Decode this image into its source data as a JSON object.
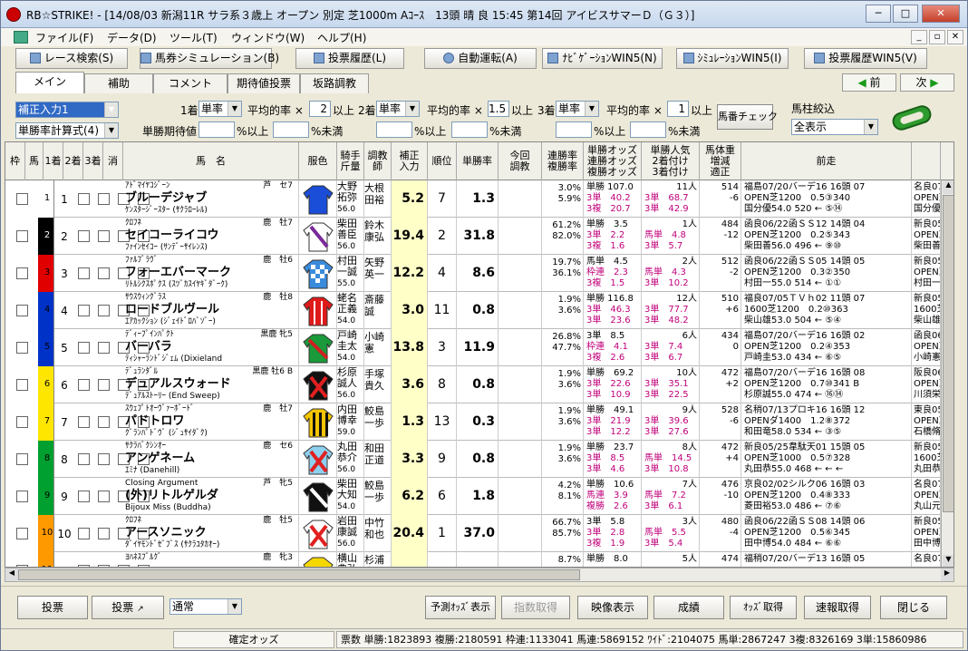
{
  "window": {
    "title": "RB☆STRIKE! - [14/08/03 新潟11R サラ系３歳上 オープン 別定 芝1000m Aｺｰｽ　13頭 晴 良 15:45 第14回 アイビスサマーＤ（Ｇ３）]"
  },
  "menu": [
    "ファイル(F)",
    "データ(D)",
    "ツール(T)",
    "ウィンドウ(W)",
    "ヘルプ(H)"
  ],
  "toolbar": [
    "レース検索(S)",
    "馬券シミュレーション(B)",
    "投票履歴(L)",
    "自動運転(A)",
    "ﾅﾋﾞｹﾞｰｼｮﾝWIN5(N)",
    "ｼﾐｭﾚｰｼｮﾝWIN5(I)",
    "投票履歴WIN5(V)"
  ],
  "tabs": [
    "メイン",
    "補助",
    "コメント",
    "期待値投票",
    "坂路調教"
  ],
  "nav": {
    "prev": "前",
    "next": "次"
  },
  "filter": {
    "preset": "補正入力1",
    "sort": "単勝率計算式(4)",
    "l1": "1着",
    "l2": "2着",
    "l3": "3着",
    "bet1": "単率",
    "bet2": "単率",
    "bet3": "単率",
    "avg": "平均的率 ×",
    "avg1": "2",
    "avg2": "1.5",
    "avg3": "1",
    "ijou": "以上",
    "exp": "単勝期待値",
    "pct_ijou": "%以上",
    "pct_miman": "%未満",
    "umaban_check": "馬番チェック",
    "hashira": "馬柱絞込",
    "display": "全表示"
  },
  "headers": [
    "枠",
    "馬",
    "1着",
    "2着",
    "3着",
    "消",
    "馬　名",
    "服色",
    "騎手\n斤量",
    "調教\n師",
    "補正\n入力",
    "順位",
    "単勝率",
    "今回\n調教",
    "連勝率\n複勝率",
    "単勝オッズ\n連勝オッズ\n複勝オッズ",
    "単勝人気\n2着付け\n3着付け",
    "馬体重\n増減\n適正",
    "前走",
    ""
  ],
  "colors": {
    "waku": [
      "#ffffff",
      "#000000",
      "#e00000",
      "#0032c8",
      "#ffe600",
      "#00a030",
      "#ff9900",
      "#ff80c0"
    ]
  },
  "rows": [
    {
      "waku": "1",
      "wc": 0,
      "num": "1",
      "sire": "ｱﾄﾞﾏｲﾔｺｼﾞｰﾝ",
      "sex": "芦　セ7",
      "name": "ブルーデジャブ",
      "dam": "ｹﾝｽﾀｰｼﾞｰｽﾀｰ (ｻｸﾗﾛｰﾚﾙ)",
      "jockey": "大野\n拓弥",
      "kg": "56.0",
      "trainer": "大根\n田裕",
      "hosei": "5.2",
      "rank": "7",
      "tan": "1.3",
      "ren": "3.0%",
      "fuku": "5.9%",
      "o1": "単勝 107.0",
      "o2": "3単　40.2",
      "o3": "3複　20.7",
      "p1": "11人",
      "p2": "3単　68.7",
      "p3": "3単　42.9",
      "w1": "514",
      "w2": "-6",
      "prev1": "福島07/20バーデ16 16頭 07",
      "prev2": "OPEN芝1200　0.5③340",
      "prev3": "国分優54.0 520 ← ⑤⑭",
      "last1": "名良07",
      "last2": "OPEN芝",
      "last3": "国分優",
      "silk": "blue"
    },
    {
      "waku": "2",
      "wc": 1,
      "num": "2",
      "sire": "ｸﾛﾌﾈ",
      "sex": "鹿　牡7",
      "name": "セイコーライコウ",
      "dam": "ﾌｧｲﾝｾｲｺｰ (ｻﾝﾃﾞｰｻｲﾚﾝｽ)",
      "jockey": "柴田\n善臣",
      "kg": "56.0",
      "trainer": "鈴木\n康弘",
      "hosei": "19.4",
      "rank": "2",
      "tan": "31.8",
      "ren": "61.2%",
      "fuku": "82.0%",
      "o1": "単勝　3.5",
      "o2": "3単　2.2",
      "o3": "3複　1.6",
      "p1": "1人",
      "p2": "馬単　4.8",
      "p3": "3単　5.7",
      "w1": "484",
      "w2": "-12",
      "prev1": "函良06/22函ＳＳ12 14頭 04",
      "prev2": "OPEN芝1200　0.2⑤343",
      "prev3": "柴田善56.0 496 ← ⑨⑩",
      "last1": "新良05",
      "last2": "OPEN芝",
      "last3": "柴田善",
      "silk": "white"
    },
    {
      "waku": "3",
      "wc": 2,
      "num": "3",
      "sire": "ﾌｧﾙﾌﾞﾗｳﾞ",
      "sex": "鹿　牡6",
      "name": "フォーエバーマーク",
      "dam": "ﾘﾄﾙｼｸｽﾎﾟｸｽ (ｽﾂﾞｶｽｲﾔｷﾞﾀﾞｰｸ)",
      "jockey": "村田\n一誠",
      "kg": "55.0",
      "trainer": "矢野\n英一",
      "hosei": "12.2",
      "rank": "4",
      "tan": "8.6",
      "ren": "19.7%",
      "fuku": "36.1%",
      "o1": "馬単　4.5",
      "o2": "枠連　2.3",
      "o3": "3複　1.5",
      "p1": "2人",
      "p2": "馬単　4.3",
      "p3": "3単　10.2",
      "w1": "512",
      "w2": "-2",
      "prev1": "函良06/22函ＳＳ05 14頭 05",
      "prev2": "OPEN芝1200　0.3②350",
      "prev3": "村田一55.0 514 ← ①①",
      "last1": "新良05",
      "last2": "OPEN芝",
      "last3": "村田一",
      "silk": "check"
    },
    {
      "waku": "4",
      "wc": 3,
      "num": "4",
      "sire": "ｻｳｽｳｨﾝｸﾞﾗｽ",
      "sex": "鹿　牡8",
      "name": "ロードブルヴール",
      "dam": "ｴｱｶｯｸｼｮﾝ (ｼﾞｪｲﾄﾞﾛﾊﾞｿﾞｰ)",
      "jockey": "蛯名\n正義",
      "kg": "54.0",
      "trainer": "斎藤\n誠",
      "hosei": "3.0",
      "rank": "11",
      "tan": "0.8",
      "ren": "1.9%",
      "fuku": "3.6%",
      "o1": "単勝 116.8",
      "o2": "3単　46.3",
      "o3": "3単　23.6",
      "p1": "12人",
      "p2": "3単　77.7",
      "p3": "3単　48.2",
      "w1": "510",
      "w2": "+6",
      "prev1": "福良07/05ＴＶｈ02 11頭 07",
      "prev2": "1600芝1200　0.2⑩363",
      "prev3": "柴山雄53.0 504 ← ⑤④",
      "last1": "新良05",
      "last2": "1600芝",
      "last3": "柴山雄",
      "silk": "red"
    },
    {
      "waku": "5",
      "wc": 3,
      "num": "5",
      "sire": "ﾃﾞｨｰﾌﾟｲﾝﾊﾟｸﾄ",
      "sex": "黒鹿 牝5",
      "name": "バーバラ",
      "dam": "ﾃｨｼｬｰﾗﾝﾄﾞｼﾞｪﾑ (Dixieland",
      "jockey": "戸崎\n圭太",
      "kg": "54.0",
      "trainer": "小崎\n憲",
      "hosei": "13.8",
      "rank": "3",
      "tan": "11.9",
      "ren": "26.8%",
      "fuku": "47.7%",
      "o1": "3単　8.5",
      "o2": "枠連　4.1",
      "o3": "3複　2.6",
      "p1": "6人",
      "p2": "3単　7.4",
      "p3": "3単　6.7",
      "w1": "434",
      "w2": "0",
      "prev1": "福島07/20バーデ16 16頭 02",
      "prev2": "OPEN芝1200　0.2④353",
      "prev3": "戸崎圭53.0 434 ← ⑥⑤",
      "last1": "函良06",
      "last2": "OPEN芝",
      "last3": "小崎憲",
      "silk": "green"
    },
    {
      "waku": "6",
      "wc": 4,
      "num": "6",
      "sire": "ﾃﾞｭﾗﾝﾀﾞﾙ",
      "sex": "黒鹿 牡6 B",
      "name": "デュアルスウォード",
      "dam": "ﾃﾞｭｱﾙｽﾄｰﾘｰ (End Sweep)",
      "jockey": "杉原\n誠人",
      "kg": "56.0",
      "trainer": "手塚\n貴久",
      "hosei": "3.6",
      "rank": "8",
      "tan": "0.8",
      "ren": "1.9%",
      "fuku": "3.6%",
      "o1": "単勝　69.2",
      "o2": "3単　22.6",
      "o3": "3単　10.9",
      "p1": "10人",
      "p2": "3単　35.1",
      "p3": "3単　22.5",
      "w1": "472",
      "w2": "+2",
      "prev1": "福島07/20バーデ16 16頭 08",
      "prev2": "OPEN芝1200　0.7⑩341 B",
      "prev3": "杉原誠55.0 474 ← ⑯⑭",
      "last1": "阪良06",
      "last2": "OPEN芝",
      "last3": "川須栄",
      "silk": "redx"
    },
    {
      "waku": "7",
      "wc": 4,
      "num": "7",
      "sire": "ｽｳｪﾌﾟﾄｵｰｳﾞｧｰﾎﾞｰﾄﾞ",
      "sex": "鹿　牡7",
      "name": "パドトロワ",
      "dam": "ｸﾞﾗﾝﾊﾟﾄﾞｳﾞ (ｼﾞｭｻｲﾀﾞｸ)",
      "jockey": "内田\n博幸",
      "kg": "59.0",
      "trainer": "鮫島\n一歩",
      "hosei": "1.3",
      "rank": "13",
      "tan": "0.3",
      "ren": "1.9%",
      "fuku": "3.6%",
      "o1": "単勝　49.1",
      "o2": "3単　21.9",
      "o3": "3単　12.2",
      "p1": "9人",
      "p2": "3単　39.6",
      "p3": "3単　27.6",
      "w1": "528",
      "w2": "-6",
      "prev1": "名稍07/13プロキ16 16頭 12",
      "prev2": "OPENダ1400　1.2⑧372",
      "prev3": "和田竜58.0 534 ← ③⑤",
      "last1": "東良05",
      "last2": "OPEN芝",
      "last3": "石橋脩",
      "silk": "stripe"
    },
    {
      "waku": "8",
      "wc": 5,
      "num": "8",
      "sire": "ｻｸﾗﾊﾞｸｼﾝｵｰ",
      "sex": "鹿　セ6",
      "name": "アンゲネーム",
      "dam": "ｴﾐﾅ (Danehill)",
      "jockey": "丸田\n恭介",
      "kg": "56.0",
      "trainer": "和田\n正道",
      "hosei": "3.3",
      "rank": "9",
      "tan": "0.8",
      "ren": "1.9%",
      "fuku": "3.6%",
      "o1": "単勝　23.7",
      "o2": "3単　8.5",
      "o3": "3単　4.6",
      "p1": "8人",
      "p2": "馬単　14.5",
      "p3": "3単　10.8",
      "w1": "472",
      "w2": "+4",
      "prev1": "新良05/25韋駄天01 15頭 05",
      "prev2": "OPEN芝1000　0.5⑦328",
      "prev3": "丸田恭55.0 468 ← ← ←",
      "last1": "新良05",
      "last2": "1600芝",
      "last3": "丸田恭",
      "silk": "lightblue"
    },
    {
      "waku": "9",
      "wc": 5,
      "num": "9",
      "sire": "Closing Argument",
      "sex": "芦　牝5",
      "name": "(外)リトルゲルダ",
      "dam": "Bijoux Miss (Buddha)",
      "jockey": "柴田\n大知",
      "kg": "54.0",
      "trainer": "鮫島\n一歩",
      "hosei": "6.2",
      "rank": "6",
      "tan": "1.8",
      "ren": "4.2%",
      "fuku": "8.1%",
      "o1": "単勝　10.6",
      "o2": "馬連　3.9",
      "o3": "複勝　2.6",
      "p1": "7人",
      "p2": "馬単　7.2",
      "p3": "3単　6.1",
      "w1": "476",
      "w2": "-10",
      "prev1": "京良02/02シルク06 16頭 03",
      "prev2": "OPEN芝1200　0.4⑧333",
      "prev3": "菱田裕53.0 486 ← ⑦⑥",
      "last1": "名良07",
      "last2": "OPEN芝",
      "last3": "丸山元",
      "silk": "blackw"
    },
    {
      "waku": "10",
      "wc": 6,
      "num": "10",
      "sire": "ｸﾛﾌﾈ",
      "sex": "鹿　牡5",
      "name": "アースソニック",
      "dam": "ﾀﾞｲﾔﾓﾝﾄﾞｾﾞﾌﾞｽ (ｻｸﾗﾕﾀｶｵｰ)",
      "jockey": "岩田\n康誠",
      "kg": "56.0",
      "trainer": "中竹\n和也",
      "hosei": "20.4",
      "rank": "1",
      "tan": "37.0",
      "ren": "66.7%",
      "fuku": "85.7%",
      "o1": "3単　5.8",
      "o2": "3単　2.8",
      "o3": "3複　1.9",
      "p1": "3人",
      "p2": "馬単　5.5",
      "p3": "3単　5.4",
      "w1": "480",
      "w2": "-4",
      "prev1": "函良06/22函ＳＳ08 14頭 06",
      "prev2": "OPEN芝1200　0.5⑥345",
      "prev3": "田中博54.0 484 ← ⑥⑥",
      "last1": "新良05",
      "last2": "OPEN芝",
      "last3": "田中博",
      "silk": "redxw"
    },
    {
      "waku": "11",
      "wc": 6,
      "num": "11",
      "sire": "ﾖﾊﾈｽﾌﾞﾙｸﾞ",
      "sex": "鹿　牝3",
      "name": "",
      "dam": "",
      "jockey": "横山\n典弘",
      "kg": "",
      "trainer": "杉浦\n宏昭",
      "hosei": "",
      "rank": "",
      "tan": "",
      "ren": "8.7%",
      "fuku": "",
      "o1": "単勝　8.0",
      "o2": "",
      "o3": "",
      "p1": "5人",
      "p2": "",
      "p3": "",
      "w1": "474",
      "w2": "",
      "prev1": "福稍07/20バーデ13 16頭 05",
      "prev2": "",
      "prev3": "",
      "last1": "名良07",
      "last2": "",
      "last3": "",
      "silk": "yellow"
    }
  ],
  "bottom": [
    "投票",
    "投票",
    "通常",
    "予測ｵｯｽﾞ表示",
    "指数取得",
    "映像表示",
    "成績",
    "ｵｯｽﾞ取得",
    "速報取得",
    "閉じる"
  ],
  "status": {
    "kakutei": "確定オッズ",
    "votes": "票数 単勝:1823893 複勝:2180591 枠連:1133041 馬連:5869152 ﾜｲﾄﾞ:2104075 馬単:2867247 3複:8326169 3単:15860986"
  }
}
